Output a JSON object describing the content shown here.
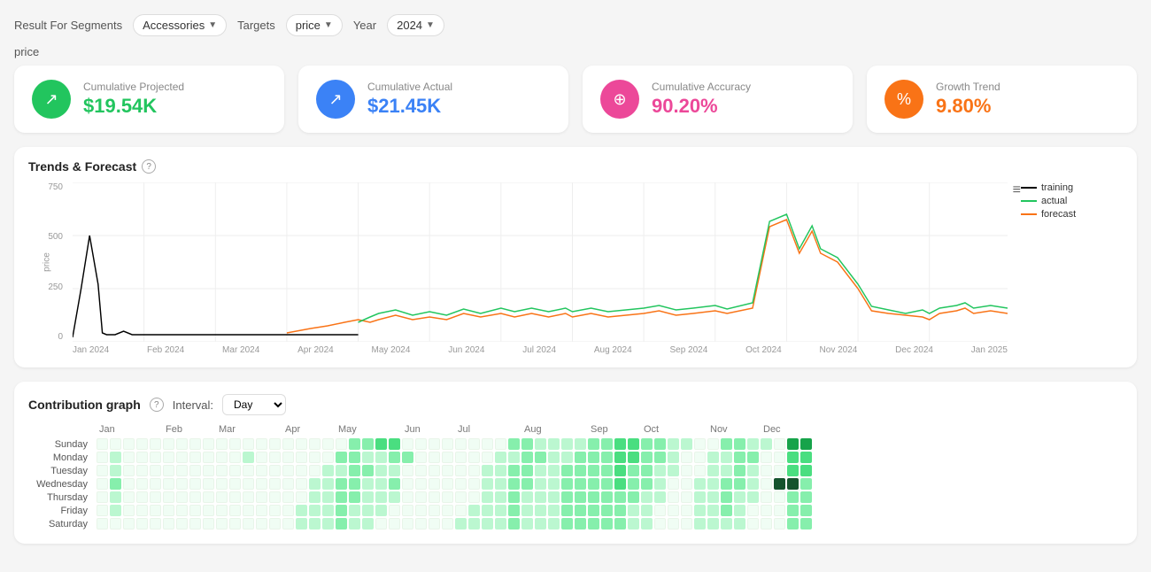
{
  "header": {
    "result_label": "Result For Segments",
    "segment_label": "Accessories",
    "targets_label": "Targets",
    "target_value": "price",
    "year_label": "Year",
    "year_value": "2024"
  },
  "price_label": "price",
  "kpis": [
    {
      "id": "projected",
      "title": "Cumulative Projected",
      "value": "$19.54K",
      "icon": "↗",
      "icon_class": "icon-green",
      "val_class": "val-green"
    },
    {
      "id": "actual",
      "title": "Cumulative Actual",
      "value": "$21.45K",
      "icon": "↗",
      "icon_class": "icon-blue",
      "val_class": "val-blue"
    },
    {
      "id": "accuracy",
      "title": "Cumulative Accuracy",
      "value": "90.20%",
      "icon": "⊕",
      "icon_class": "icon-pink",
      "val_class": "val-pink"
    },
    {
      "id": "growth",
      "title": "Growth Trend",
      "value": "9.80%",
      "icon": "%",
      "icon_class": "icon-orange",
      "val_class": "val-orange"
    }
  ],
  "trends_chart": {
    "title": "Trends & Forecast",
    "y_labels": [
      "750",
      "500",
      "250",
      "0"
    ],
    "y_axis_title": "price",
    "x_labels": [
      "Jan 2024",
      "Feb 2024",
      "Mar 2024",
      "Apr 2024",
      "May 2024",
      "Jun 2024",
      "Jul 2024",
      "Aug 2024",
      "Sep 2024",
      "Oct 2024",
      "Nov 2024",
      "Dec 2024",
      "Jan 2025"
    ],
    "legend": [
      {
        "label": "training",
        "color": "#000000"
      },
      {
        "label": "actual",
        "color": "#22c55e"
      },
      {
        "label": "forecast",
        "color": "#f97316"
      }
    ]
  },
  "contribution": {
    "title": "Contribution graph",
    "interval_label": "Interval:",
    "interval_value": "Day",
    "months": [
      "Jan",
      "Feb",
      "Mar",
      "Apr",
      "May",
      "Jun",
      "Jul",
      "Aug",
      "Sep",
      "Oct",
      "Nov",
      "Dec"
    ],
    "days": [
      "Sunday",
      "Monday",
      "Tuesday",
      "Wednesday",
      "Thursday",
      "Friday",
      "Saturday"
    ],
    "grid": {
      "Sunday": [
        0,
        0,
        0,
        0,
        0,
        0,
        0,
        0,
        0,
        0,
        0,
        0,
        0,
        0,
        0,
        0,
        0,
        0,
        0,
        2,
        2,
        3,
        3,
        0,
        0,
        0,
        0,
        0,
        0,
        0,
        0,
        2,
        2,
        1,
        1,
        1,
        1,
        2,
        2,
        3,
        3,
        2,
        2,
        1,
        1,
        0,
        0,
        2,
        2,
        1,
        1,
        0,
        4,
        4
      ],
      "Monday": [
        0,
        1,
        0,
        0,
        0,
        0,
        0,
        0,
        0,
        0,
        0,
        1,
        0,
        0,
        0,
        0,
        0,
        0,
        2,
        2,
        1,
        1,
        2,
        2,
        0,
        0,
        0,
        0,
        0,
        0,
        1,
        1,
        2,
        2,
        1,
        1,
        2,
        2,
        2,
        3,
        3,
        2,
        2,
        1,
        0,
        0,
        1,
        1,
        2,
        2,
        0,
        0,
        3,
        3
      ],
      "Tuesday": [
        0,
        1,
        0,
        0,
        0,
        0,
        0,
        0,
        0,
        0,
        0,
        0,
        0,
        0,
        0,
        0,
        0,
        1,
        1,
        2,
        2,
        1,
        1,
        0,
        0,
        0,
        0,
        0,
        0,
        1,
        1,
        2,
        2,
        1,
        1,
        2,
        2,
        2,
        2,
        3,
        2,
        2,
        1,
        1,
        0,
        0,
        1,
        1,
        2,
        1,
        0,
        0,
        3,
        3
      ],
      "Wednesday": [
        0,
        2,
        0,
        0,
        0,
        0,
        0,
        0,
        0,
        0,
        0,
        0,
        0,
        0,
        0,
        0,
        1,
        1,
        2,
        2,
        1,
        1,
        2,
        0,
        0,
        0,
        0,
        0,
        0,
        1,
        1,
        2,
        2,
        1,
        1,
        2,
        2,
        2,
        2,
        3,
        2,
        2,
        1,
        0,
        0,
        1,
        1,
        2,
        2,
        1,
        0,
        5,
        5,
        2
      ],
      "Thursday": [
        0,
        1,
        0,
        0,
        0,
        0,
        0,
        0,
        0,
        0,
        0,
        0,
        0,
        0,
        0,
        0,
        1,
        1,
        2,
        2,
        1,
        1,
        1,
        0,
        0,
        0,
        0,
        0,
        0,
        1,
        1,
        2,
        1,
        1,
        1,
        2,
        2,
        2,
        2,
        2,
        2,
        1,
        1,
        0,
        0,
        1,
        1,
        2,
        1,
        1,
        0,
        0,
        2,
        2
      ],
      "Friday": [
        0,
        1,
        0,
        0,
        0,
        0,
        0,
        0,
        0,
        0,
        0,
        0,
        0,
        0,
        0,
        1,
        1,
        1,
        2,
        1,
        1,
        1,
        0,
        0,
        0,
        0,
        0,
        0,
        1,
        1,
        1,
        2,
        1,
        1,
        1,
        2,
        2,
        2,
        2,
        2,
        1,
        1,
        0,
        0,
        0,
        1,
        1,
        2,
        1,
        0,
        0,
        0,
        2,
        2
      ],
      "Saturday": [
        0,
        0,
        0,
        0,
        0,
        0,
        0,
        0,
        0,
        0,
        0,
        0,
        0,
        0,
        0,
        1,
        1,
        1,
        2,
        1,
        1,
        0,
        0,
        0,
        0,
        0,
        0,
        1,
        1,
        1,
        1,
        2,
        1,
        1,
        1,
        2,
        2,
        2,
        2,
        2,
        1,
        1,
        0,
        0,
        0,
        1,
        1,
        1,
        1,
        0,
        0,
        0,
        2,
        2
      ]
    }
  }
}
